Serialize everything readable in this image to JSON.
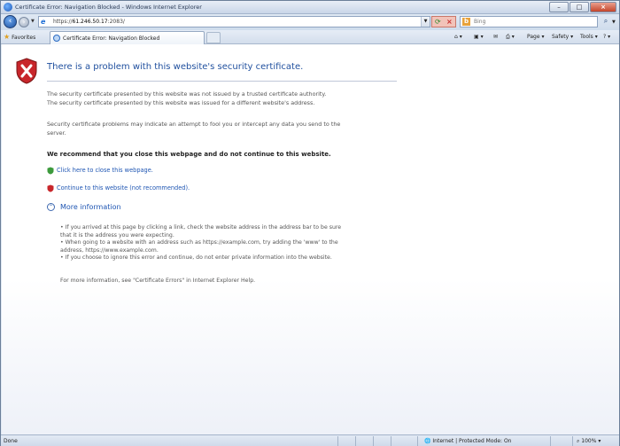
{
  "window": {
    "title": "Certificate Error: Navigation Blocked - Windows Internet Explorer"
  },
  "address_bar": {
    "url_prefix": "https://",
    "url_host": "61.246.50.17",
    "url_suffix": ":2083/"
  },
  "search": {
    "placeholder": "Bing"
  },
  "favorites": {
    "label": "Favorites"
  },
  "tab": {
    "label": "Certificate Error: Navigation Blocked"
  },
  "commands": {
    "page": "Page",
    "safety": "Safety",
    "tools": "Tools"
  },
  "error_page": {
    "title": "There is a problem with this website's security certificate.",
    "para1_line1": "The security certificate presented by this website was not issued by a trusted certificate authority.",
    "para1_line2": "The security certificate presented by this website was issued for a different website's address.",
    "para2_line1": "Security certificate problems may indicate an attempt to fool you or intercept any data you send to the",
    "para2_line2": "server.",
    "recommend": "We recommend that you close this webpage and do not continue to this website.",
    "close_link": "Click here to close this webpage.",
    "continue_link": "Continue to this website (not recommended).",
    "more_info": "More information",
    "bullets": [
      "•  If you arrived at this page by clicking a link, check the website address in the address bar to be sure",
      "   that it is the address you were expecting.",
      "•  When going to a website with an address such as https://example.com, try adding the 'www' to the",
      "   address, https://www.example.com.",
      "•  If you choose to ignore this error and continue, do not enter private information into the website."
    ],
    "footer": "For more information, see \"Certificate Errors\" in Internet Explorer Help."
  },
  "status_bar": {
    "status": "Done",
    "zone": "Internet | Protected Mode: On",
    "zoom": "100%"
  },
  "colors": {
    "link": "#1f56b3",
    "title": "#1f4f9e",
    "shield_red": "#c8262b"
  }
}
